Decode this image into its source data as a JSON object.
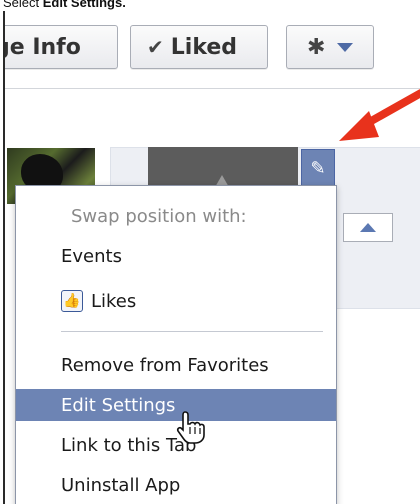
{
  "instruction": {
    "prefix": "Select ",
    "emphasis": "Edit Settings."
  },
  "toolbar": {
    "page_info_label": "ge Info",
    "liked_label": "Liked",
    "check_glyph": "✔",
    "gear_glyph": "✱"
  },
  "pencil_glyph": "✎",
  "menu": {
    "header": "Swap position with:",
    "items": [
      {
        "label": "Events"
      },
      {
        "label": "Likes",
        "icon": "like-thumb-icon"
      },
      {
        "label": "Remove from Favorites"
      },
      {
        "label": "Edit Settings",
        "highlighted": true
      },
      {
        "label": "Link to this Tab"
      },
      {
        "label": "Uninstall App"
      }
    ]
  },
  "icons": {
    "like_glyph": "👍"
  },
  "colors": {
    "accent_blue": "#6d84b4",
    "annotation_red": "#e8321c",
    "menu_border": "#8c95a8"
  }
}
